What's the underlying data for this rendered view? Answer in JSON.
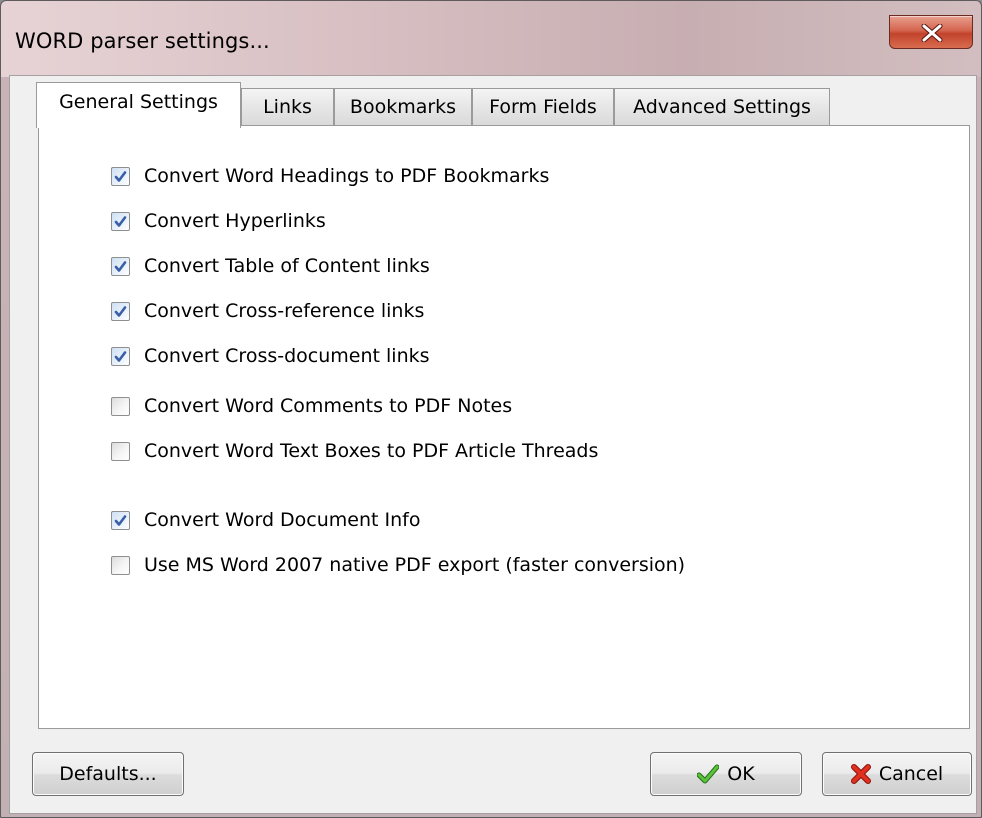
{
  "window": {
    "title": "WORD parser settings..."
  },
  "tabs": [
    {
      "label": "General Settings",
      "active": true
    },
    {
      "label": "Links",
      "active": false
    },
    {
      "label": "Bookmarks",
      "active": false
    },
    {
      "label": "Form Fields",
      "active": false
    },
    {
      "label": "Advanced Settings",
      "active": false
    }
  ],
  "options": [
    {
      "label": "Convert Word Headings to PDF Bookmarks",
      "checked": true
    },
    {
      "label": "Convert Hyperlinks",
      "checked": true
    },
    {
      "label": "Convert Table of Content links",
      "checked": true
    },
    {
      "label": "Convert Cross-reference links",
      "checked": true
    },
    {
      "label": "Convert Cross-document links",
      "checked": true
    },
    {
      "label": "Convert Word Comments to PDF Notes",
      "checked": false
    },
    {
      "label": "Convert Word Text Boxes to PDF Article Threads",
      "checked": false
    },
    {
      "label": "Convert Word Document Info",
      "checked": true
    },
    {
      "label": "Use MS Word 2007 native PDF export (faster conversion)",
      "checked": false
    }
  ],
  "buttons": {
    "defaults": "Defaults...",
    "ok": "OK",
    "cancel": "Cancel"
  },
  "icons": {
    "close": "close-icon",
    "ok": "checkmark-icon",
    "cancel": "red-x-icon",
    "checkbox_checked": "checkmark-icon"
  },
  "colors": {
    "close_button": "#c2432c",
    "ok_check": "#3d9b2b",
    "cancel_x": "#d7261c",
    "checkbox_check": "#3a5fa6"
  }
}
